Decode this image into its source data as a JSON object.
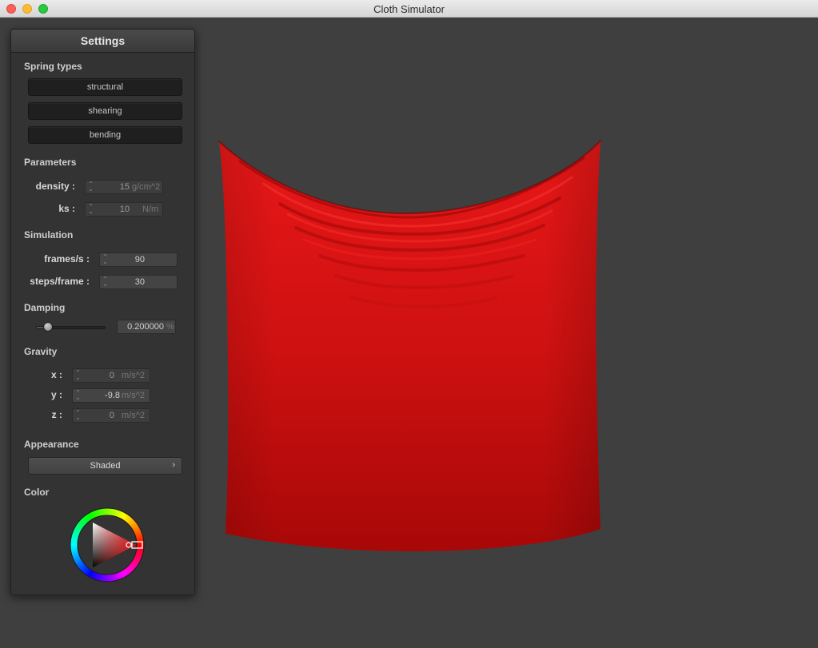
{
  "window": {
    "title": "Cloth Simulator"
  },
  "panel": {
    "title": "Settings",
    "spring_types": {
      "heading": "Spring types",
      "buttons": [
        "structural",
        "shearing",
        "bending"
      ]
    },
    "parameters": {
      "heading": "Parameters",
      "density": {
        "label": "density :",
        "value": "15",
        "unit": "g/cm^2"
      },
      "ks": {
        "label": "ks :",
        "value": "10",
        "unit": "N/m"
      }
    },
    "simulation": {
      "heading": "Simulation",
      "fps": {
        "label": "frames/s :",
        "value": "90"
      },
      "steps": {
        "label": "steps/frame :",
        "value": "30"
      }
    },
    "damping": {
      "heading": "Damping",
      "value": "0.200000",
      "unit": "%",
      "slider_fraction": 0.2
    },
    "gravity": {
      "heading": "Gravity",
      "x": {
        "label": "x :",
        "value": "0",
        "unit": "m/s^2"
      },
      "y": {
        "label": "y :",
        "value": "-9.8",
        "unit": "m/s^2"
      },
      "z": {
        "label": "z :",
        "value": "0",
        "unit": "m/s^2"
      }
    },
    "appearance": {
      "heading": "Appearance",
      "selected": "Shaded"
    },
    "color": {
      "heading": "Color",
      "current": "#e01010"
    }
  },
  "colors": {
    "cloth": "#cc1010",
    "background": "#3f3f3f",
    "panel": "#333333"
  }
}
